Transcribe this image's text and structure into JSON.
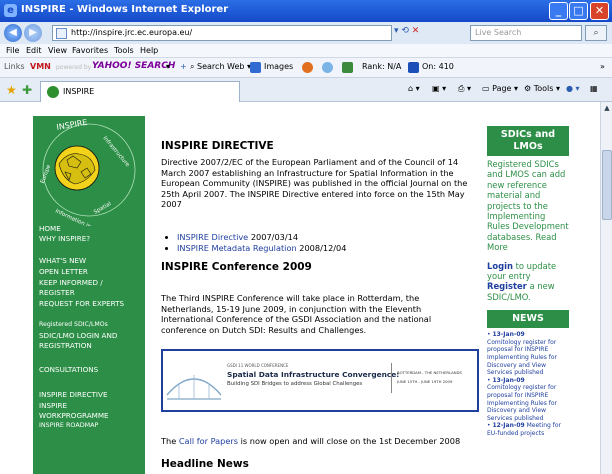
{
  "window": {
    "title": "INSPIRE - Windows Internet Explorer",
    "minimize": "_",
    "maximize": "□",
    "close": "✕"
  },
  "address": {
    "url": "http://inspire.jrc.ec.europa.eu/",
    "search_placeholder": "Live Search"
  },
  "menu": [
    "File",
    "Edit",
    "View",
    "Favorites",
    "Tools",
    "Help"
  ],
  "links_bar": {
    "links": "Links",
    "vmn": "VMN",
    "powered": "powered by",
    "yahoo": "YAHOO! SEARCH",
    "search_web": "Search Web",
    "images": "Images",
    "rank": "Rank: N/A",
    "on": "On: 410"
  },
  "tab": {
    "title": "INSPIRE"
  },
  "command_bar": {
    "page": "Page",
    "tools": "Tools"
  },
  "leftnav": {
    "logo_text": "INSPIRE · Infrastructure for Spatial Information in Europe",
    "items": [
      "HOME",
      "WHY INSPIRE?",
      "WHAT'S NEW",
      "OPEN LETTER",
      "KEEP INFORMED /",
      "REGISTER",
      "REQUEST FOR EXPERTS",
      "Registered SDIC/LMOs",
      "SDIC/LMO LOGIN and",
      "REGISTRATION",
      "CONSULTATIONS",
      "INSPIRE DIRECTIVE",
      "INSPIRE",
      "WORKPROGRAMME",
      "INSPIRE ROADMAP"
    ]
  },
  "main": {
    "directive_heading": "INSPIRE DIRECTIVE",
    "directive_text": "Directive 2007/2/EC of the European Parliament and of the Council of 14 March 2007 establishing an Infrastructure for Spatial Information in the European Community (INSPIRE) was published in the official Journal on the 25th April 2007. The INSPIRE Directive entered into force on the 15th May 2007",
    "bullets": [
      {
        "link": "INSPIRE Directive",
        "date": "2007/03/14"
      },
      {
        "link": "INSPIRE Metadata Regulation",
        "date": "2008/12/04"
      }
    ],
    "conf_heading": "INSPIRE Conference 2009",
    "conf_text": "The Third INSPIRE Conference will take place in Rotterdam, the Netherlands, 15-19 June 2009, in conjunction with the Eleventh International Conference of the GSDI Association and the national conference on Dutch SDI: Results and Challenges.",
    "banner": {
      "small": "GSDI 11 WORLD CONFERENCE",
      "title": "Spatial Data Infrastructure Convergence:",
      "sub": "Building SDI Bridges to address Global Challenges",
      "place": "ROTTERDAM - THE NETHERLANDS",
      "dates": "JUNE 15TH - JUNE 19TH 2009"
    },
    "call_link": "Call for Papers",
    "call_pre": "The",
    "call_post": "is now open and will close on the 1st December 2008",
    "headline": "Headline News"
  },
  "right": {
    "sdic_heading": "SDICs and LMOs",
    "sdic_text": "Registered SDICs and LMOS can add new reference material and projects to the Implementing Rules Development databases. Read More",
    "login": "Login",
    "login_post": "to update your entry",
    "register": "Register",
    "register_post": "a new SDIC/LMO.",
    "news_heading": "NEWS",
    "news": [
      {
        "date": "13-Jan-09",
        "text": "Comitology register for proposal for INSPIRE Implementing Rules for Discovery and View Services published"
      },
      {
        "date": "13-Jan-09",
        "text": "Comitology register for proposal for INSPIRE Implementing Rules for Discovery and View Services published"
      },
      {
        "date": "12-Jan-09",
        "text": "Meeting for EU-funded projects"
      }
    ]
  }
}
